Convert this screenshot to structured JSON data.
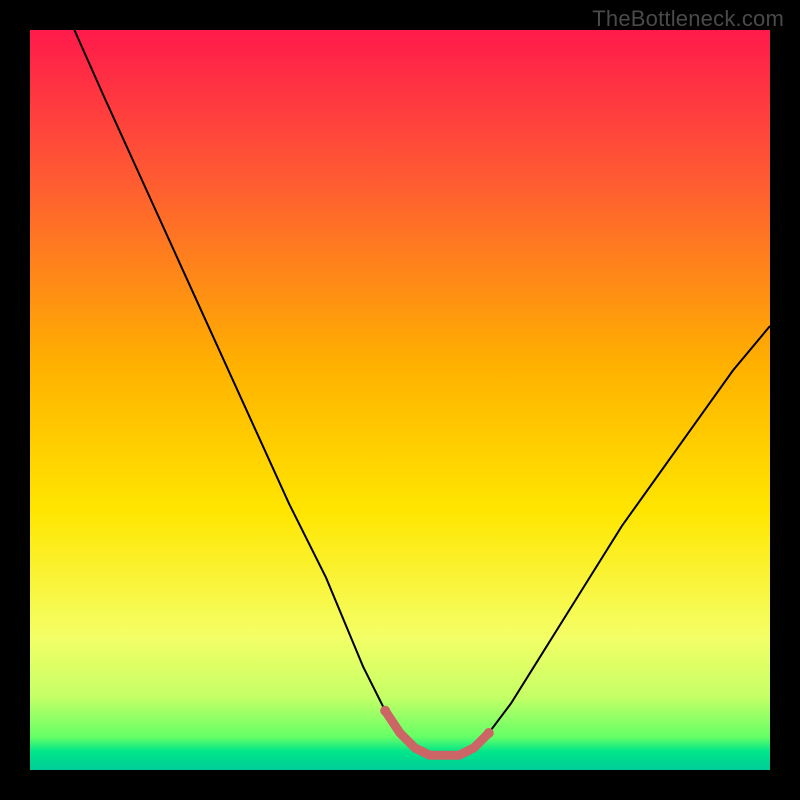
{
  "watermark": "TheBottleneck.com",
  "chart_data": {
    "type": "line",
    "title": "",
    "xlabel": "",
    "ylabel": "",
    "xlim": [
      0,
      100
    ],
    "ylim": [
      0,
      100
    ],
    "series": [
      {
        "name": "bottleneck-curve",
        "x": [
          6,
          10,
          15,
          20,
          25,
          30,
          35,
          40,
          45,
          48,
          50,
          52,
          54,
          56,
          58,
          60,
          62,
          65,
          70,
          75,
          80,
          85,
          90,
          95,
          100
        ],
        "y": [
          100,
          91,
          80,
          69,
          58,
          47,
          36,
          26,
          14,
          8,
          5,
          3,
          2,
          2,
          2,
          3,
          5,
          9,
          17,
          25,
          33,
          40,
          47,
          54,
          60
        ]
      },
      {
        "name": "optimal-zone-highlight",
        "x": [
          48,
          50,
          52,
          54,
          56,
          58,
          60,
          62
        ],
        "y": [
          8,
          5,
          3,
          2,
          2,
          2,
          3,
          5
        ]
      }
    ],
    "gradient_stops": [
      {
        "offset": 0.0,
        "color": "#ff1a4b"
      },
      {
        "offset": 0.2,
        "color": "#ff5a33"
      },
      {
        "offset": 0.45,
        "color": "#ffb000"
      },
      {
        "offset": 0.65,
        "color": "#ffe600"
      },
      {
        "offset": 0.82,
        "color": "#f4ff66"
      },
      {
        "offset": 0.9,
        "color": "#c6ff66"
      },
      {
        "offset": 0.955,
        "color": "#66ff66"
      },
      {
        "offset": 0.975,
        "color": "#00e68a"
      },
      {
        "offset": 1.0,
        "color": "#00cc99"
      }
    ],
    "highlight_color": "#cc6666",
    "curve_color": "#000000"
  }
}
